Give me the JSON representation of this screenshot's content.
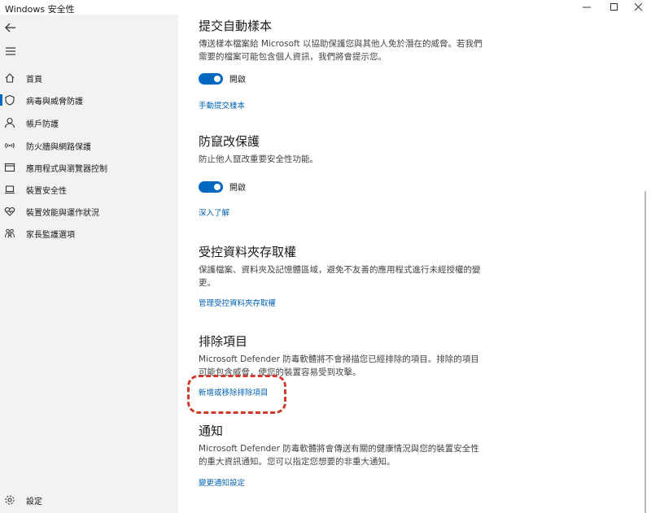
{
  "window": {
    "title": "Windows 安全性",
    "minimize_symbol": "—",
    "maximize_symbol": "☐",
    "close_symbol": "✕"
  },
  "sidebar": {
    "back_icon": "back-arrow-icon",
    "menu_icon": "hamburger-menu-icon",
    "items": [
      {
        "label": "首頁",
        "icon": "home-icon"
      },
      {
        "label": "病毒與威脅防護",
        "icon": "shield-icon",
        "selected": true
      },
      {
        "label": "帳戶防護",
        "icon": "person-icon"
      },
      {
        "label": "防火牆與網路保護",
        "icon": "wifi-icon"
      },
      {
        "label": "應用程式與瀏覽器控制",
        "icon": "browser-window-icon"
      },
      {
        "label": "裝置安全性",
        "icon": "laptop-icon"
      },
      {
        "label": "裝置效能與運作狀況",
        "icon": "heart-icon"
      },
      {
        "label": "家長監護選項",
        "icon": "family-icon"
      }
    ],
    "settings_label": "設定",
    "settings_icon": "gear-icon"
  },
  "main": {
    "sample_submission": {
      "title": "提交自動樣本",
      "description": "傳送樣本檔案給 Microsoft 以協助保護您與其他人免於潛在的威脅。若我們需要的檔案可能包含個人資訊，我們將會提示您。",
      "toggle_label": "開啟",
      "toggle_on": true,
      "link": "手動提交樣本"
    },
    "tamper_protection": {
      "title": "防竄改保護",
      "description": "防止他人竄改重要安全性功能。",
      "toggle_label": "開啟",
      "toggle_on": true,
      "link": "深入了解"
    },
    "controlled_folder": {
      "title": "受控資料夾存取權",
      "description": "保護檔案、資料夾及記憶體區域，避免不友善的應用程式進行未經授權的變更。",
      "link": "管理受控資料夾存取權"
    },
    "exclusions": {
      "title": "排除項目",
      "description": "Microsoft Defender 防毒軟體將不會掃描您已經排除的項目。排除的項目可能包含威脅，使您的裝置容易受到攻擊。",
      "link": "新增或移除排除項目"
    },
    "notifications": {
      "title": "通知",
      "description": "Microsoft Defender 防毒軟體將會傳送有關的健康情況與您的裝置安全性的重大資訊通知。您可以指定您想要的非重大通知。",
      "link": "變更通知設定"
    }
  },
  "colors": {
    "accent": "#0067c0",
    "link": "#0062b8",
    "highlight": "#d23a2c",
    "sidebar_bg": "#f2f2f2"
  }
}
